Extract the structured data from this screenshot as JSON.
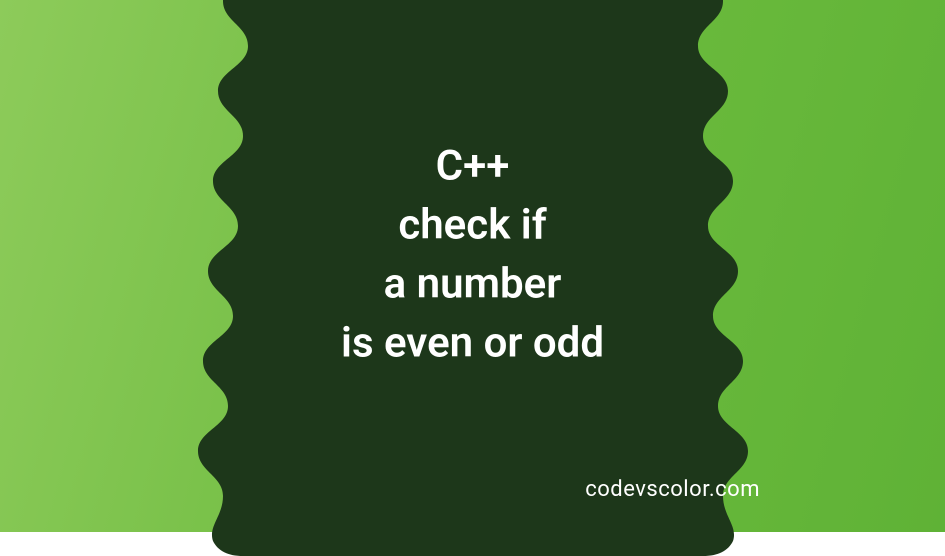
{
  "title": {
    "line1": "C++",
    "line2": "check if",
    "line3": "a number",
    "line4": "is even or odd"
  },
  "watermark": "codevscolor.com",
  "colors": {
    "blob": "#1d371a",
    "gradientStart": "#8dcb5a",
    "gradientEnd": "#5fb236",
    "text": "#ffffff"
  }
}
